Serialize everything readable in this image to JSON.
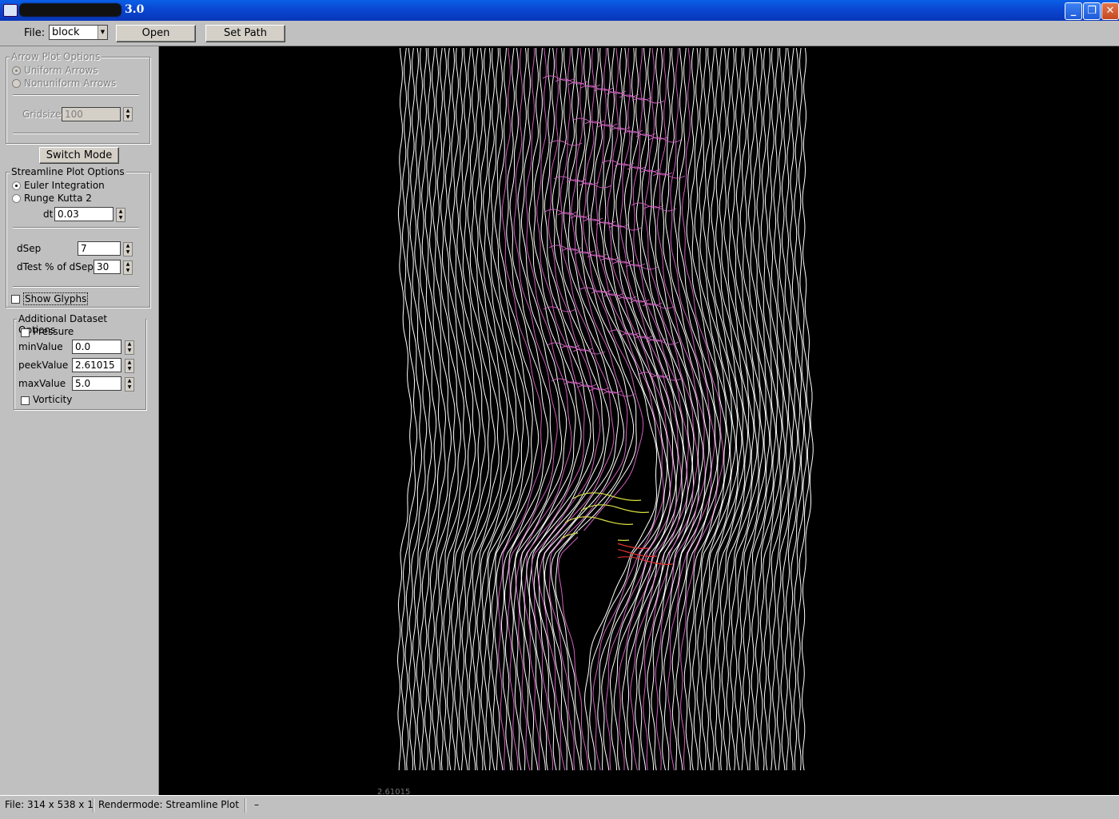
{
  "window": {
    "title_suffix": "3.0",
    "minimize": "_",
    "restore": "❐",
    "close": "✕"
  },
  "toolbar": {
    "file_label": "File:",
    "file_value": "block",
    "open_label": "Open",
    "set_path_label": "Set Path"
  },
  "arrow_options": {
    "title": "Arrow Plot Options",
    "uniform_label": "Uniform Arrows",
    "nonuniform_label": "Nonuniform Arrows",
    "gridsize_label": "Gridsize",
    "gridsize_value": "100"
  },
  "switch_mode_label": "Switch Mode",
  "streamline_options": {
    "title": "Streamline Plot Options",
    "euler_label": "Euler Integration",
    "rk2_label": "Runge Kutta 2",
    "dt_label": "dt",
    "dt_value": "0.03",
    "dsep_label": "dSep",
    "dsep_value": "7",
    "dtest_label": "dTest % of dSep",
    "dtest_value": "30",
    "show_glyphs_label": "Show Glyphs"
  },
  "dataset_options": {
    "title": "Additional Dataset Options",
    "pressure_label": "Pressure",
    "min_label": "minValue",
    "min_value": "0.0",
    "peek_label": "peekValue",
    "peek_value": "2.61015",
    "max_label": "maxValue",
    "max_value": "5.0",
    "vorticity_label": "Vorticity"
  },
  "canvas": {
    "peek_readout": "2.61015"
  },
  "status": {
    "file_info": "File: 314 x 538 x 1",
    "rendermode": "Rendermode: Streamline Plot",
    "extra": "–"
  },
  "colors": {
    "streamline": "#ffffff",
    "high_pressure": "#d060c0",
    "wake_yellow": "#d8e040",
    "wake_red": "#e03030",
    "background": "#000000"
  }
}
